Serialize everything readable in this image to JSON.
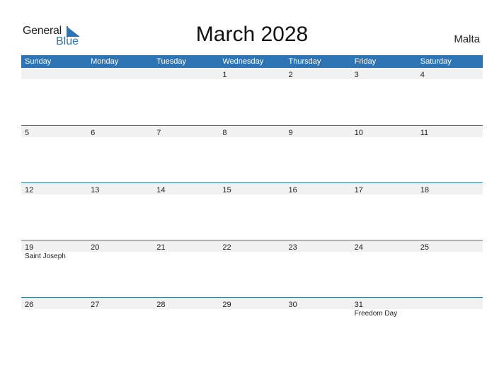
{
  "logo": {
    "text_top": "General",
    "text_bottom": "Blue"
  },
  "title": "March 2028",
  "country": "Malta",
  "colors": {
    "accent": "#2e74b5",
    "day_bar": "#f1f1f1"
  },
  "weekdays": [
    "Sunday",
    "Monday",
    "Tuesday",
    "Wednesday",
    "Thursday",
    "Friday",
    "Saturday"
  ],
  "weeks": [
    {
      "days": [
        "",
        "",
        "",
        "1",
        "2",
        "3",
        "4"
      ],
      "events": [
        "",
        "",
        "",
        "",
        "",
        "",
        ""
      ]
    },
    {
      "days": [
        "5",
        "6",
        "7",
        "8",
        "9",
        "10",
        "11"
      ],
      "events": [
        "",
        "",
        "",
        "",
        "",
        "",
        ""
      ]
    },
    {
      "days": [
        "12",
        "13",
        "14",
        "15",
        "16",
        "17",
        "18"
      ],
      "events": [
        "",
        "",
        "",
        "",
        "",
        "",
        ""
      ]
    },
    {
      "days": [
        "19",
        "20",
        "21",
        "22",
        "23",
        "24",
        "25"
      ],
      "events": [
        "Saint Joseph",
        "",
        "",
        "",
        "",
        "",
        ""
      ]
    },
    {
      "days": [
        "26",
        "27",
        "28",
        "29",
        "30",
        "31",
        ""
      ],
      "events": [
        "",
        "",
        "",
        "",
        "",
        "Freedom Day",
        ""
      ]
    }
  ]
}
